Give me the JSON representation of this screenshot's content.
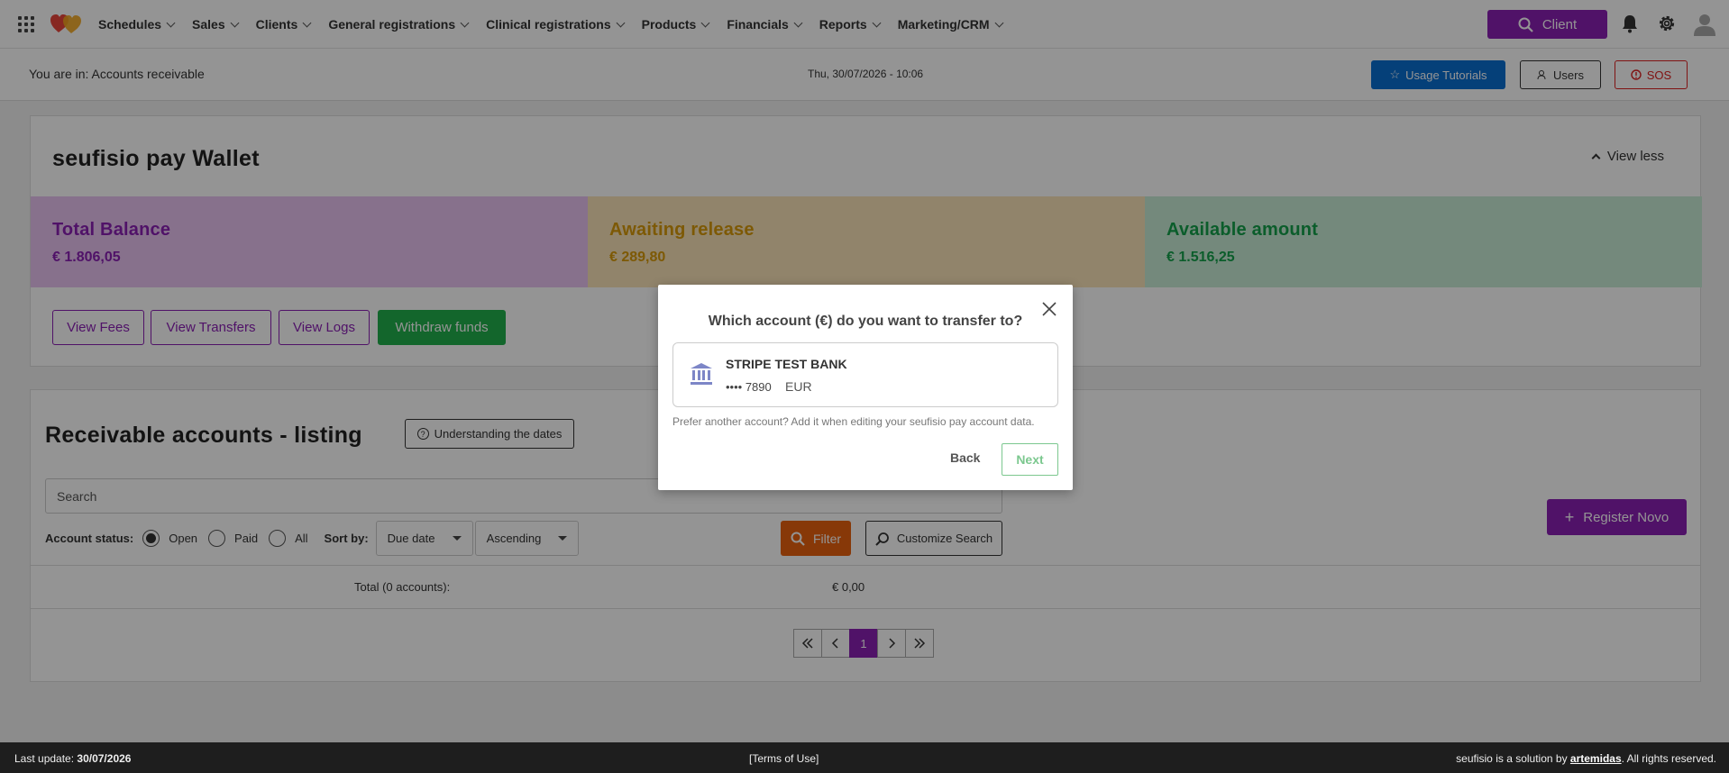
{
  "nav": {
    "items": [
      {
        "label": "Schedules"
      },
      {
        "label": "Sales"
      },
      {
        "label": "Clients"
      },
      {
        "label": "General registrations"
      },
      {
        "label": "Clinical registrations"
      },
      {
        "label": "Products"
      },
      {
        "label": "Financials"
      },
      {
        "label": "Reports"
      },
      {
        "label": "Marketing/CRM"
      }
    ],
    "client_button": "Client"
  },
  "subheader": {
    "breadcrumb": "You are in: Accounts receivable",
    "datetime": "Thu, 30/07/2026 - 10:06",
    "tutorials": "Usage Tutorials",
    "users": "Users",
    "sos": "SOS"
  },
  "wallet": {
    "title": "seufisio pay Wallet",
    "view_less": "View less",
    "total_label": "Total Balance",
    "total_value": "€ 1.806,05",
    "awaiting_label": "Awaiting release",
    "awaiting_value": "€ 289,80",
    "available_label": "Available amount",
    "available_value": "€ 1.516,25",
    "buttons": {
      "fees": "View Fees",
      "transfers": "View Transfers",
      "logs": "View Logs",
      "withdraw": "Withdraw funds"
    }
  },
  "receivable": {
    "title": "Receivable accounts - listing",
    "dates_button": "Understanding the dates",
    "search_placeholder": "Search",
    "status_label": "Account status:",
    "status_open": "Open",
    "status_paid": "Paid",
    "status_all": "All",
    "sort_label": "Sort by:",
    "sort_field": "Due date",
    "sort_order": "Ascending",
    "filter": "Filter",
    "customize": "Customize Search",
    "register": "Register Novo",
    "total_label": "Total (0 accounts):",
    "total_value": "€ 0,00",
    "current_page": "1"
  },
  "footer": {
    "last_update_label": "Last update:",
    "last_update_value": "30/07/2026",
    "terms": "[Terms of Use]",
    "solution_prefix": "seufisio is a solution by",
    "brand": "artemidas",
    "rights": ". All rights reserved."
  },
  "modal": {
    "title": "Which account (€) do you want to transfer to?",
    "bank_name": "STRIPE TEST BANK",
    "account_mask": "•••• 7890",
    "currency": "EUR",
    "hint": "Prefer another account? Add it when editing your seufisio pay account data.",
    "back": "Back",
    "next": "Next"
  },
  "colors": {
    "brand_purple": "#8a1fb4",
    "tutorial_blue": "#0a6ed1",
    "sos_red": "#dd2222",
    "withdraw_green": "#22b04d",
    "filter_orange": "#e8610f",
    "awaiting_gold": "#d89a0a",
    "available_green": "#14a04a"
  },
  "icons": {
    "apps": "apps-grid-icon",
    "logo": "hearts-logo",
    "search": "search-icon",
    "bell": "bell-icon",
    "settings": "gear-icon",
    "avatar": "user-avatar-icon",
    "star": "star-icon",
    "users": "users-icon",
    "sos": "alert-circle-icon",
    "bank": "bank-icon",
    "close": "close-icon"
  }
}
